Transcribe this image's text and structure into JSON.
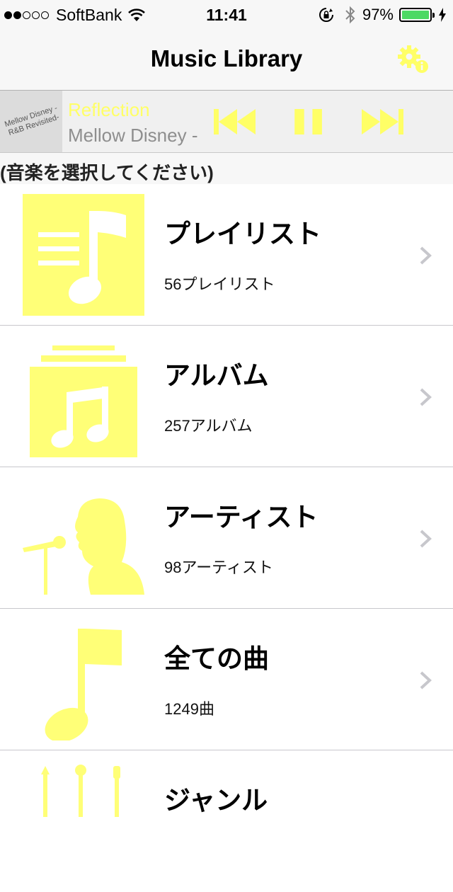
{
  "status_bar": {
    "carrier": "SoftBank",
    "time": "11:41",
    "battery_percent": "97%",
    "battery_level": 0.97,
    "signal_bars": 2
  },
  "nav": {
    "title": "Music Library",
    "settings_icon": "gear-icon"
  },
  "now_playing": {
    "artwork_text": "Mellow Disney - R&B Revisited-",
    "title": "Reflection",
    "artist": "Mellow Disney -",
    "controls": [
      "previous-icon",
      "pause-icon",
      "next-icon"
    ]
  },
  "section_header": "(音楽を選択してください)",
  "categories": [
    {
      "title": "プレイリスト",
      "subtitle": "56プレイリスト",
      "icon": "playlist-icon"
    },
    {
      "title": "アルバム",
      "subtitle": "257アルバム",
      "icon": "album-icon"
    },
    {
      "title": "アーティスト",
      "subtitle": "98アーティスト",
      "icon": "artist-icon"
    },
    {
      "title": "全ての曲",
      "subtitle": "1249曲",
      "icon": "song-icon"
    },
    {
      "title": "ジャンル",
      "subtitle": "",
      "icon": "genre-icon"
    }
  ],
  "colors": {
    "accent": "#ffff66",
    "icon_yellow": "#ffff77",
    "chevron": "#c7c7cc",
    "separator": "#c8c7cc"
  }
}
